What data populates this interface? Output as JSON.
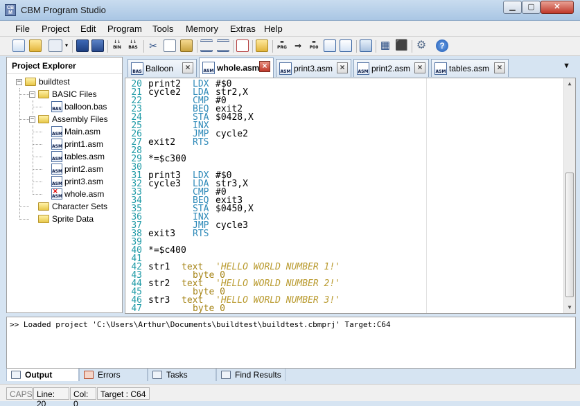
{
  "window": {
    "title": "CBM Program Studio",
    "icon_text": "CB M"
  },
  "menu": [
    "File",
    "Project",
    "Edit",
    "Program",
    "Tools",
    "Memory",
    "Extras",
    "Help"
  ],
  "toolbar_labels": {
    "bin": "BIN",
    "bas": "BAS",
    "prg": "PRG",
    "p00": "P00"
  },
  "explorer": {
    "title": "Project Explorer",
    "items": [
      {
        "label": "buildtest"
      },
      {
        "label": "BASIC Files"
      },
      {
        "label": "balloon.bas",
        "badge": "BAS"
      },
      {
        "label": "Assembly Files"
      },
      {
        "label": "Main.asm",
        "badge": "ASM"
      },
      {
        "label": "print1.asm",
        "badge": "ASM"
      },
      {
        "label": "tables.asm",
        "badge": "ASM"
      },
      {
        "label": "print2.asm",
        "badge": "ASM"
      },
      {
        "label": "print3.asm",
        "badge": "ASM"
      },
      {
        "label": "whole.asm",
        "badge": "ASM"
      },
      {
        "label": "Character Sets"
      },
      {
        "label": "Sprite Data"
      }
    ]
  },
  "tabs": [
    {
      "label": "Balloon",
      "badge": "BAS",
      "active": false
    },
    {
      "label": "whole.asm",
      "badge": "ASM",
      "active": true
    },
    {
      "label": "print3.asm",
      "badge": "ASM",
      "active": false
    },
    {
      "label": "print2.asm",
      "badge": "ASM",
      "active": false
    },
    {
      "label": "tables.asm",
      "badge": "ASM",
      "active": false
    }
  ],
  "code": [
    {
      "n": "20",
      "label": "print2",
      "op": "LDX",
      "arg": "#$0"
    },
    {
      "n": "21",
      "label": "cycle2",
      "op": "LDA",
      "arg": "str2,X"
    },
    {
      "n": "22",
      "label": "",
      "op": "CMP",
      "arg": "#0"
    },
    {
      "n": "23",
      "label": "",
      "op": "BEQ",
      "arg": "exit2"
    },
    {
      "n": "24",
      "label": "",
      "op": "STA",
      "arg": "$0428,X"
    },
    {
      "n": "25",
      "label": "",
      "op": "INX",
      "arg": ""
    },
    {
      "n": "26",
      "label": "",
      "op": "JMP",
      "arg": "cycle2"
    },
    {
      "n": "27",
      "label": "exit2",
      "op": "RTS",
      "arg": ""
    },
    {
      "n": "28",
      "label": "",
      "op": "",
      "arg": ""
    },
    {
      "n": "29",
      "label": "*=$c300",
      "op": "",
      "arg": ""
    },
    {
      "n": "30",
      "label": "",
      "op": "",
      "arg": ""
    },
    {
      "n": "31",
      "label": "print3",
      "op": "LDX",
      "arg": "#$0"
    },
    {
      "n": "32",
      "label": "cycle3",
      "op": "LDA",
      "arg": "str3,X"
    },
    {
      "n": "33",
      "label": "",
      "op": "CMP",
      "arg": "#0"
    },
    {
      "n": "34",
      "label": "",
      "op": "BEQ",
      "arg": "exit3"
    },
    {
      "n": "35",
      "label": "",
      "op": "STA",
      "arg": "$0450,X"
    },
    {
      "n": "36",
      "label": "",
      "op": "INX",
      "arg": ""
    },
    {
      "n": "37",
      "label": "",
      "op": "JMP",
      "arg": "cycle3"
    },
    {
      "n": "38",
      "label": "exit3",
      "op": "RTS",
      "arg": ""
    },
    {
      "n": "39",
      "label": "",
      "op": "",
      "arg": ""
    },
    {
      "n": "40",
      "label": "*=$c400",
      "op": "",
      "arg": ""
    },
    {
      "n": "41",
      "label": "",
      "op": "",
      "arg": ""
    },
    {
      "n": "42",
      "label": "str1",
      "kw": "text",
      "str": "'HELLO WORLD NUMBER 1!'"
    },
    {
      "n": "43",
      "label": "",
      "kw": "byte 0",
      "str": ""
    },
    {
      "n": "44",
      "label": "str2",
      "kw": "text",
      "str": "'HELLO WORLD NUMBER 2!'"
    },
    {
      "n": "45",
      "label": "",
      "kw": "byte 0",
      "str": ""
    },
    {
      "n": "46",
      "label": "str3",
      "kw": "text",
      "str": "'HELLO WORLD NUMBER 3!'"
    },
    {
      "n": "47",
      "label": "",
      "kw": "byte 0",
      "str": ""
    }
  ],
  "output": {
    "text": ">> Loaded project 'C:\\Users\\Arthur\\Documents\\buildtest\\buildtest.cbmprj' Target:C64"
  },
  "output_tabs": [
    "Output",
    "Errors",
    "Tasks",
    "Find Results"
  ],
  "status": {
    "caps": "CAPS",
    "line": "Line: 20",
    "col": "Col: 0",
    "target": "Target : C64"
  }
}
